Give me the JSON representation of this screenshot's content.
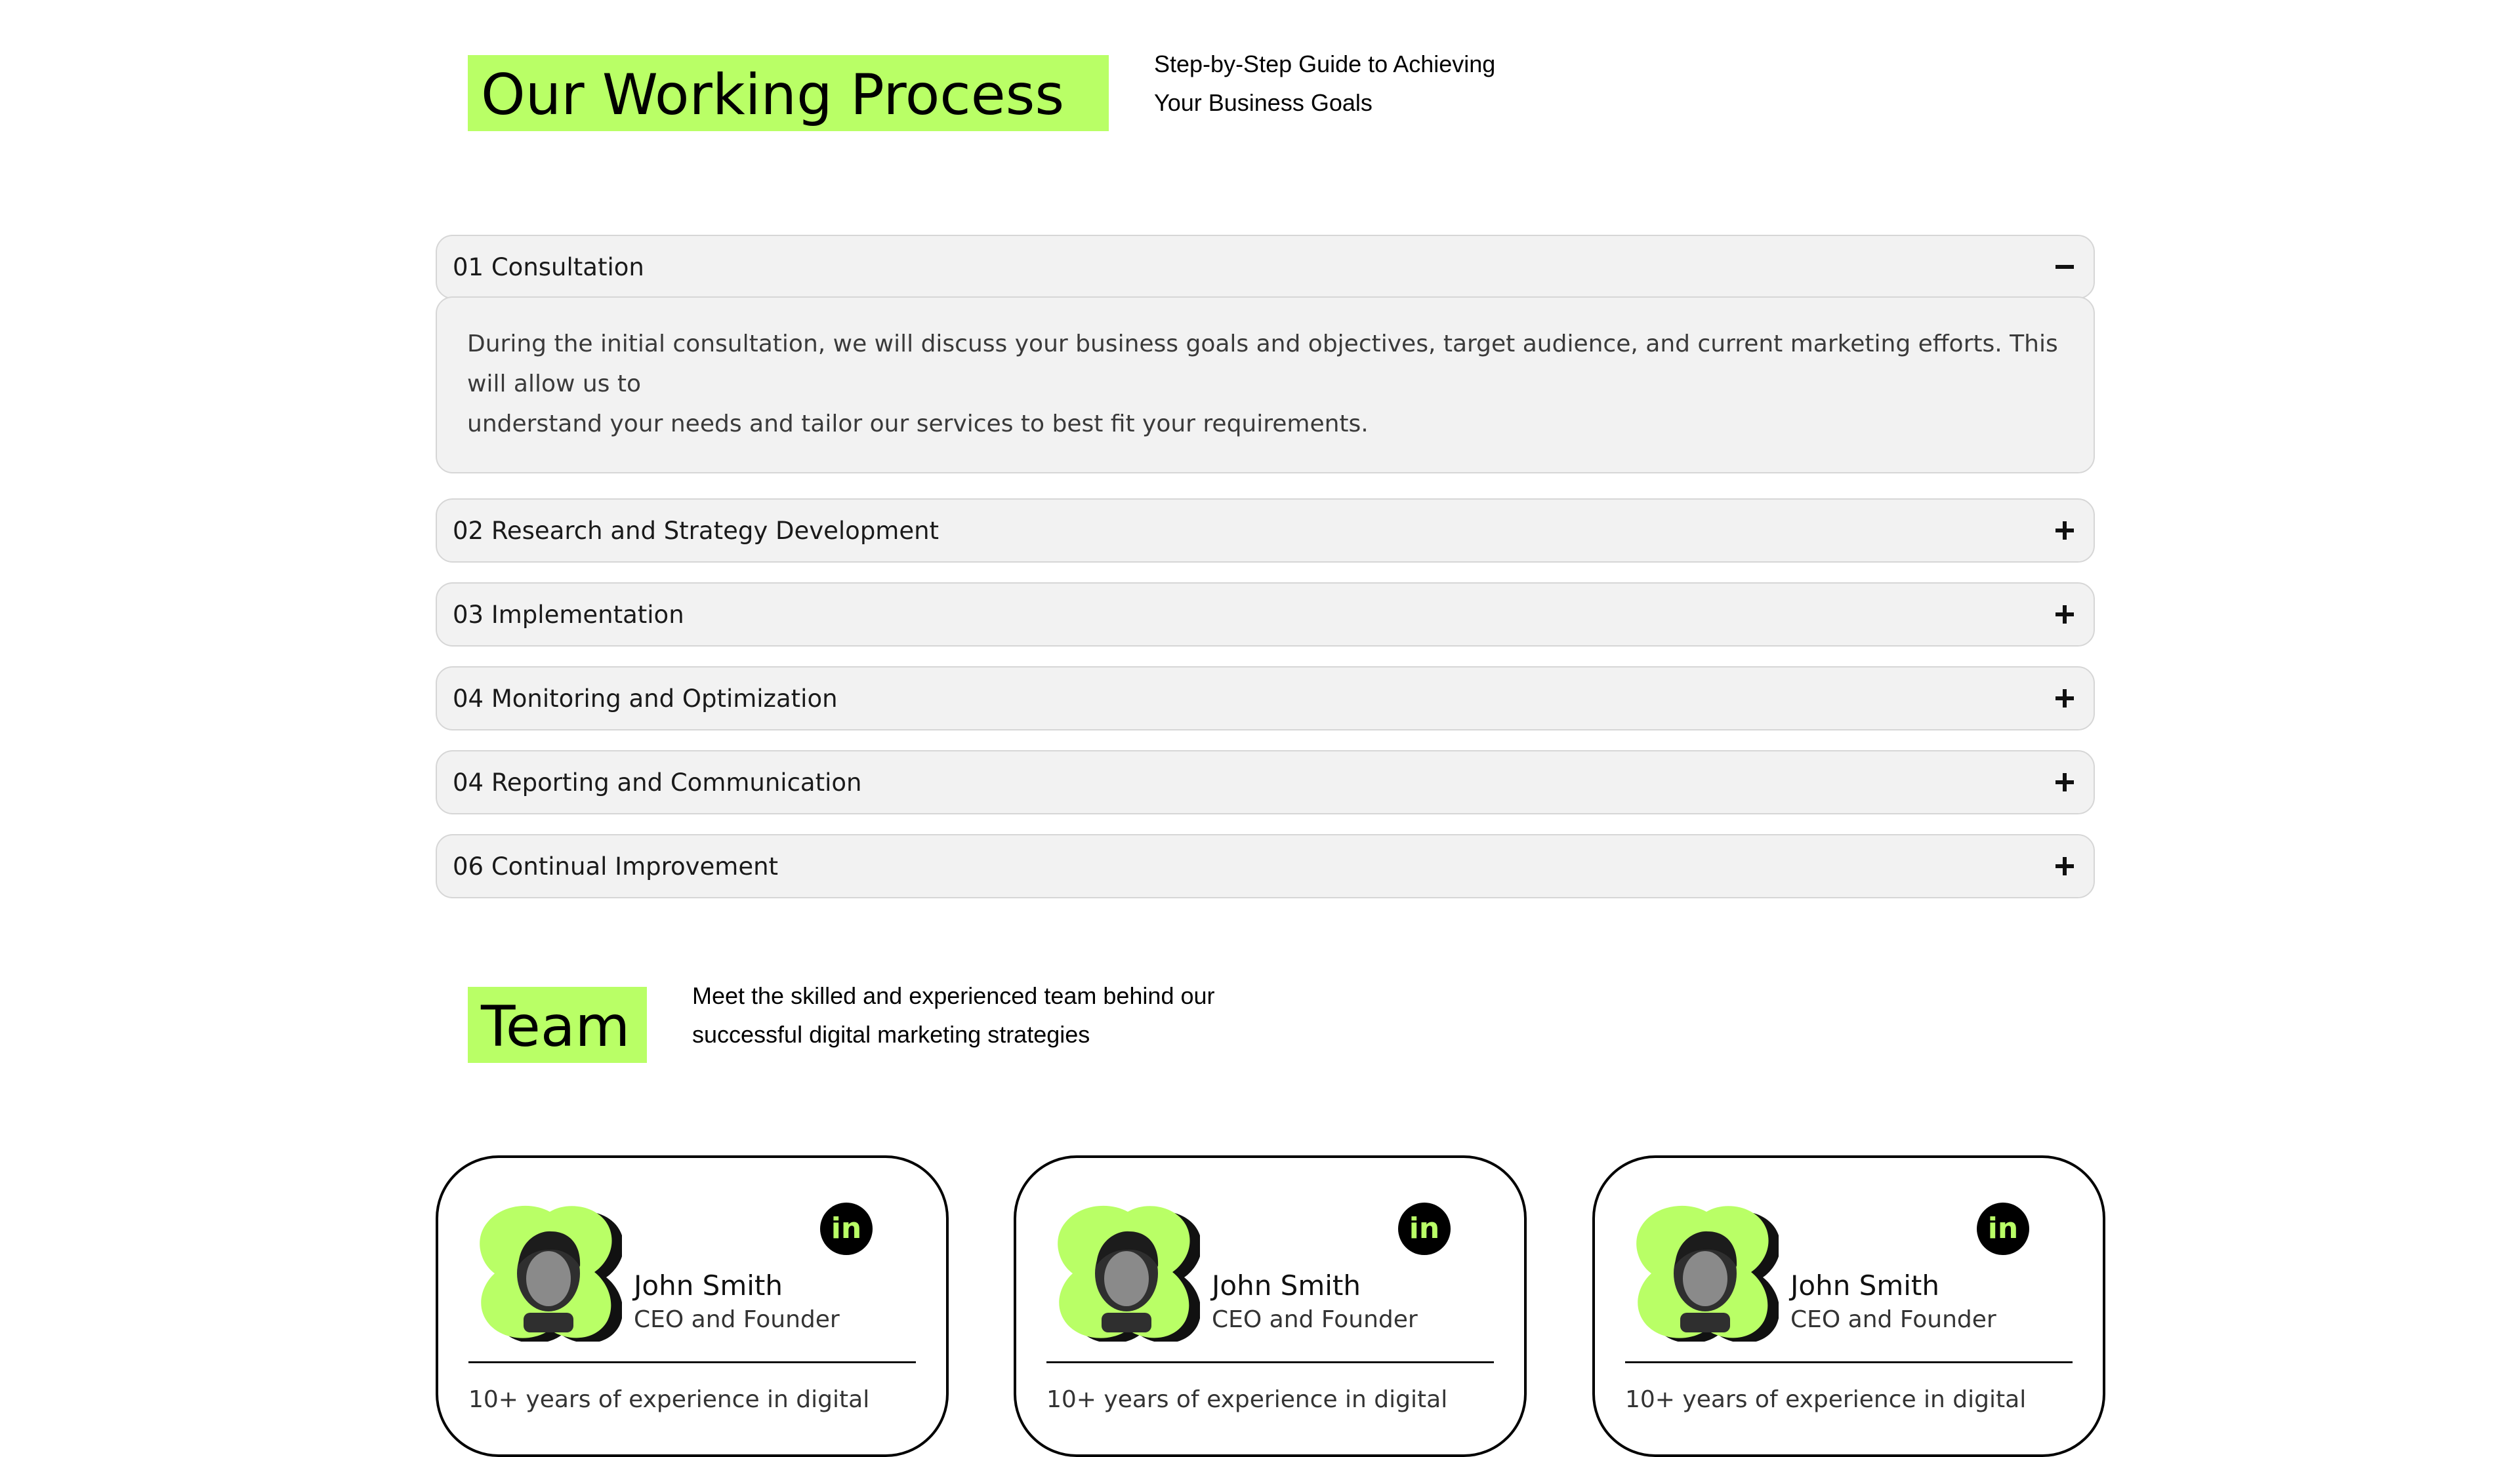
{
  "process": {
    "title": "Our Working Process",
    "subtitle_line1": "Step-by-Step Guide to Achieving",
    "subtitle_line2": "Your Business Goals",
    "items": [
      {
        "label": "01 Consultation",
        "state": "expanded",
        "icon": "minus-icon",
        "body_line1": "During the initial consultation, we will discuss your business goals and objectives, target audience, and current marketing efforts. This will allow us to",
        "body_line2": "understand your needs and tailor our services to best fit your requirements."
      },
      {
        "label": "02 Research and Strategy Development",
        "state": "collapsed",
        "icon": "plus-icon"
      },
      {
        "label": "03 Implementation",
        "state": "collapsed",
        "icon": "plus-icon"
      },
      {
        "label": "04 Monitoring and Optimization",
        "state": "collapsed",
        "icon": "plus-icon"
      },
      {
        "label": "04 Reporting and Communication",
        "state": "collapsed",
        "icon": "plus-icon"
      },
      {
        "label": "06 Continual Improvement",
        "state": "collapsed",
        "icon": "plus-icon"
      }
    ]
  },
  "team": {
    "title": "Team",
    "subtitle_line1": "Meet the skilled and experienced team behind our",
    "subtitle_line2": "successful digital marketing strategies",
    "members": [
      {
        "name": "John Smith",
        "role": "CEO and Founder",
        "desc": "10+ years of experience in digital",
        "social": "in"
      },
      {
        "name": "John Smith",
        "role": "CEO and Founder",
        "desc": "10+ years of experience in digital",
        "social": "in"
      },
      {
        "name": "John Smith",
        "role": "CEO and Founder",
        "desc": "10+ years of experience in digital",
        "social": "in"
      }
    ]
  },
  "colors": {
    "accent": "#b9ff66",
    "dark": "#000000",
    "panel": "#f2f2f2"
  }
}
